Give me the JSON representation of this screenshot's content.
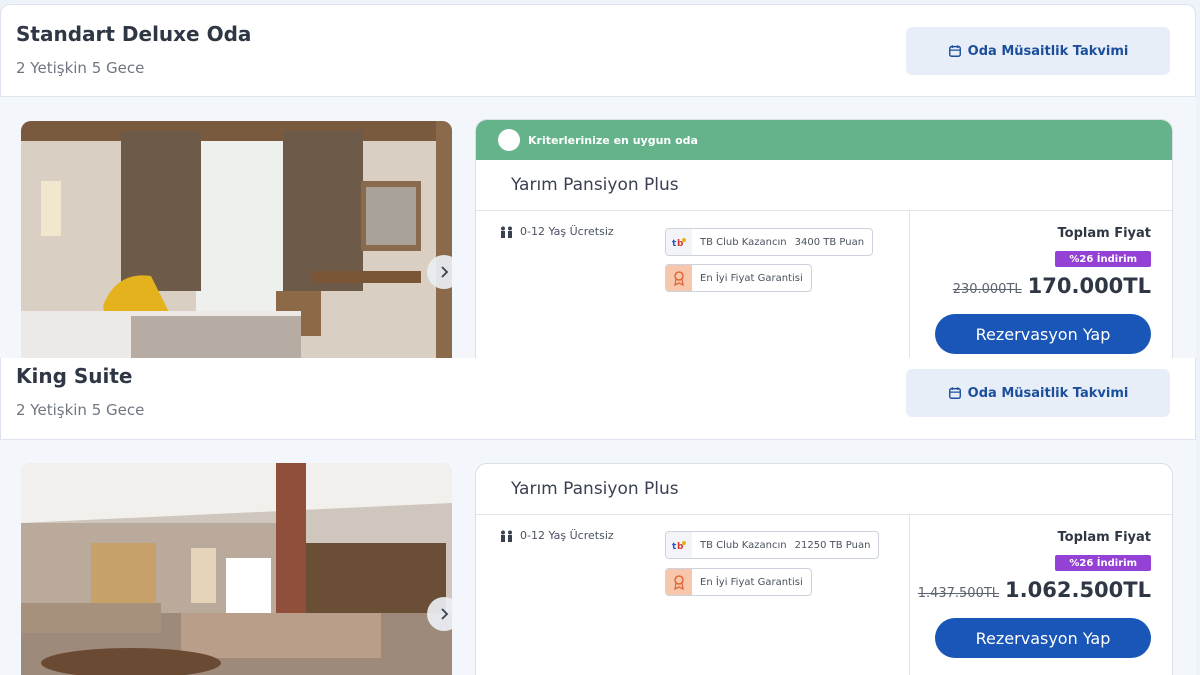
{
  "rooms": [
    {
      "title": "Standart Deluxe Oda",
      "subtitle": "2 Yetişkin 5 Gece",
      "calendar_label": "Oda Müsaitlik Takvimi",
      "banner": "Kriterlerinize en uygun oda",
      "board": "Yarım Pansiyon Plus",
      "kids_note": "0-12 Yaş Ücretsiz",
      "club_text": "TB Club Kazancın",
      "club_points": "3400 TB Puan",
      "guarantee": "En İyi Fiyat Garantisi",
      "total_label": "Toplam Fiyat",
      "discount": "%26 İndirim",
      "old_price": "230.000TL",
      "new_price": "170.000TL",
      "book_label": "Rezervasyon Yap"
    },
    {
      "title": "King Suite",
      "subtitle": "2 Yetişkin 5 Gece",
      "calendar_label": "Oda Müsaitlik Takvimi",
      "board": "Yarım Pansiyon Plus",
      "kids_note": "0-12 Yaş Ücretsiz",
      "club_text": "TB Club Kazancın",
      "club_points": "21250 TB Puan",
      "guarantee": "En İyi Fiyat Garantisi",
      "total_label": "Toplam Fiyat",
      "discount": "%26 İndirim",
      "old_price": "1.437.500TL",
      "new_price": "1.062.500TL",
      "book_label": "Rezervasyon Yap"
    }
  ],
  "icons": {
    "calendar": "calendar-icon",
    "next": "chevron-right-icon",
    "kids": "children-icon",
    "club": "tb-club-icon",
    "guarantee": "medal-icon"
  },
  "colors": {
    "banner_green": "#64b38b",
    "button_blue": "#1a55b8",
    "discount_purple": "#9441d6",
    "calendar_bg": "#e8eef8"
  }
}
